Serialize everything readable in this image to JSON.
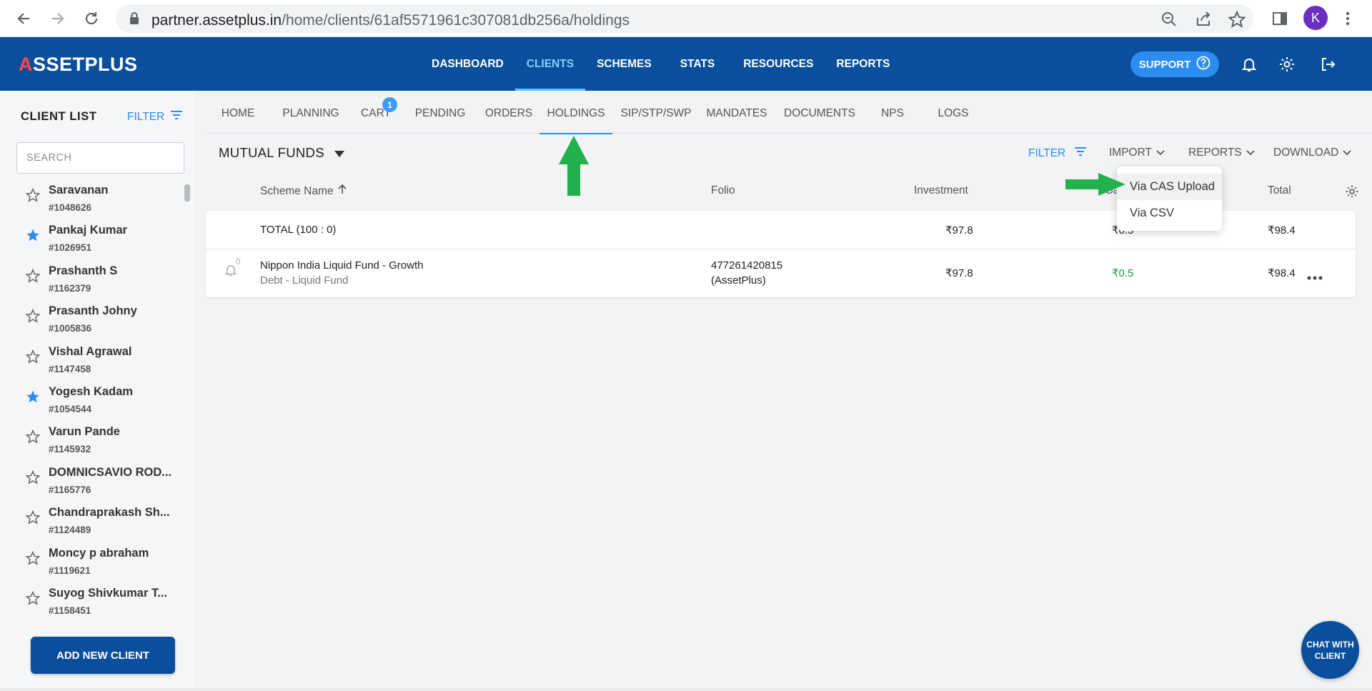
{
  "browser": {
    "url_domain": "partner.assetplus.in",
    "url_path": "/home/clients/61af5571961c307081db256a/holdings",
    "profile_initial": "K"
  },
  "header": {
    "logo": "ASSETPLUS",
    "logo_a": "A",
    "logo_rest": "SSETPLUS",
    "nav": [
      "DASHBOARD",
      "CLIENTS",
      "SCHEMES",
      "STATS",
      "RESOURCES",
      "REPORTS"
    ],
    "active_nav": "CLIENTS",
    "support_label": "SUPPORT"
  },
  "sidebar": {
    "title": "CLIENT LIST",
    "filter_label": "FILTER",
    "search_placeholder": "SEARCH",
    "clients": [
      {
        "name": "Saravanan",
        "id": "#1048626",
        "starred": false
      },
      {
        "name": "Pankaj Kumar",
        "id": "#1026951",
        "starred": true
      },
      {
        "name": "Prashanth S",
        "id": "#1162379",
        "starred": false
      },
      {
        "name": "Prasanth Johny",
        "id": "#1005836",
        "starred": false
      },
      {
        "name": "Vishal Agrawal",
        "id": "#1147458",
        "starred": false
      },
      {
        "name": "Yogesh Kadam",
        "id": "#1054544",
        "starred": true
      },
      {
        "name": "Varun Pande",
        "id": "#1145932",
        "starred": false
      },
      {
        "name": "DOMNICSAVIO ROD...",
        "id": "#1165776",
        "starred": false
      },
      {
        "name": "Chandraprakash Sh...",
        "id": "#1124489",
        "starred": false
      },
      {
        "name": "Moncy p abraham",
        "id": "#1119621",
        "starred": false
      },
      {
        "name": "Suyog Shivkumar T...",
        "id": "#1158451",
        "starred": false
      }
    ],
    "add_client_label": "ADD NEW CLIENT"
  },
  "sub_tabs": {
    "items": [
      "HOME",
      "PLANNING",
      "CART",
      "PENDING",
      "ORDERS",
      "HOLDINGS",
      "SIP/STP/SWP",
      "MANDATES",
      "DOCUMENTS",
      "NPS",
      "LOGS"
    ],
    "active": "HOLDINGS",
    "cart_count": "1"
  },
  "holdings": {
    "category": "MUTUAL FUNDS",
    "filter_label": "FILTER",
    "import_label": "IMPORT",
    "reports_label": "REPORTS",
    "download_label": "DOWNLOAD",
    "columns": {
      "scheme": "Scheme Name",
      "folio": "Folio",
      "investment": "Investment",
      "gain": "Ga",
      "total": "Total"
    },
    "total_row": {
      "label": "TOTAL (100 : 0)",
      "investment": "₹97.8",
      "gain": "₹0.5",
      "total": "₹98.4"
    },
    "rows": [
      {
        "alert_count": "0",
        "scheme": "Nippon India Liquid Fund - Growth",
        "category": "Debt - Liquid Fund",
        "folio": "477261420815",
        "folio_source": "(AssetPlus)",
        "investment": "₹97.8",
        "gain": "₹0.5",
        "total": "₹98.4"
      }
    ]
  },
  "import_menu": {
    "items": [
      "Via CAS Upload",
      "Via CSV"
    ],
    "highlighted": "Via CAS Upload"
  },
  "chat": {
    "line1": "CHAT WITH",
    "line2": "CLIENT"
  },
  "colors": {
    "brand_blue": "#0a4f9c",
    "accent_blue": "#2d8cf0",
    "gain_green": "#1d9f3a",
    "annotation_green": "#22b14c"
  }
}
